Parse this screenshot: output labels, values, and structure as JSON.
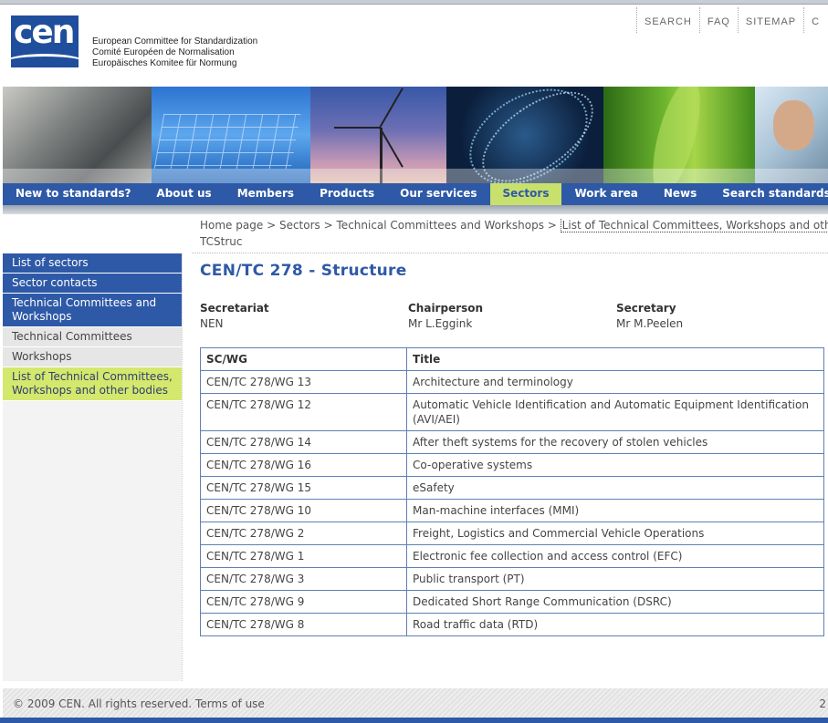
{
  "header": {
    "org_lines": [
      "European Committee for Standardization",
      "Comité Européen de Normalisation",
      "Europäisches Komitee für Normung"
    ],
    "logo_text": "cen",
    "top_links": [
      "SEARCH",
      "FAQ",
      "SITEMAP",
      "C"
    ]
  },
  "nav": {
    "items": [
      "New to standards?",
      "About us",
      "Members",
      "Products",
      "Our services",
      "Sectors",
      "Work area",
      "News",
      "Search standards"
    ],
    "active": "Sectors"
  },
  "breadcrumb": {
    "items": [
      "Home page",
      "Sectors",
      "Technical Committees and Workshops"
    ],
    "separator": ">",
    "current": "List of Technical Committees, Workshops and other bo",
    "sub": "TCStruc"
  },
  "sidebar": {
    "items": [
      {
        "label": "List of sectors",
        "style": "blue"
      },
      {
        "label": "Sector contacts",
        "style": "blue"
      },
      {
        "label": "Technical Committees and Workshops",
        "style": "blue"
      },
      {
        "label": "Technical Committees",
        "style": "grey"
      },
      {
        "label": "Workshops",
        "style": "grey"
      },
      {
        "label": "List of Technical Committees, Workshops and other bodies",
        "style": "green"
      }
    ]
  },
  "main": {
    "title": "CEN/TC 278 - Structure",
    "roles": [
      {
        "label": "Secretariat",
        "value": "NEN"
      },
      {
        "label": "Chairperson",
        "value": "Mr L.Eggink"
      },
      {
        "label": "Secretary",
        "value": "Mr M.Peelen"
      }
    ],
    "table": {
      "headers": [
        "SC/WG",
        "Title"
      ],
      "rows": [
        [
          "CEN/TC 278/WG 13",
          "Architecture and terminology"
        ],
        [
          "CEN/TC 278/WG 12",
          "Automatic Vehicle Identification and Automatic Equipment Identification (AVI/AEI)"
        ],
        [
          "CEN/TC 278/WG 14",
          "After theft systems for the recovery of stolen vehicles"
        ],
        [
          "CEN/TC 278/WG 16",
          "Co-operative systems"
        ],
        [
          "CEN/TC 278/WG 15",
          "eSafety"
        ],
        [
          "CEN/TC 278/WG 10",
          "Man-machine interfaces (MMI)"
        ],
        [
          "CEN/TC 278/WG 2",
          "Freight, Logistics and Commercial Vehicle Operations"
        ],
        [
          "CEN/TC 278/WG 1",
          "Electronic fee collection and access control (EFC)"
        ],
        [
          "CEN/TC 278/WG 3",
          "Public transport (PT)"
        ],
        [
          "CEN/TC 278/WG 9",
          "Dedicated Short Range Communication (DSRC)"
        ],
        [
          "CEN/TC 278/WG 8",
          "Road traffic data (RTD)"
        ]
      ]
    }
  },
  "footer": {
    "text": "© 2009 CEN. All rights reserved. Terms of use",
    "right": "2"
  },
  "colors": {
    "brand_blue": "#2e59a7",
    "accent_green": "#c8e06c"
  }
}
